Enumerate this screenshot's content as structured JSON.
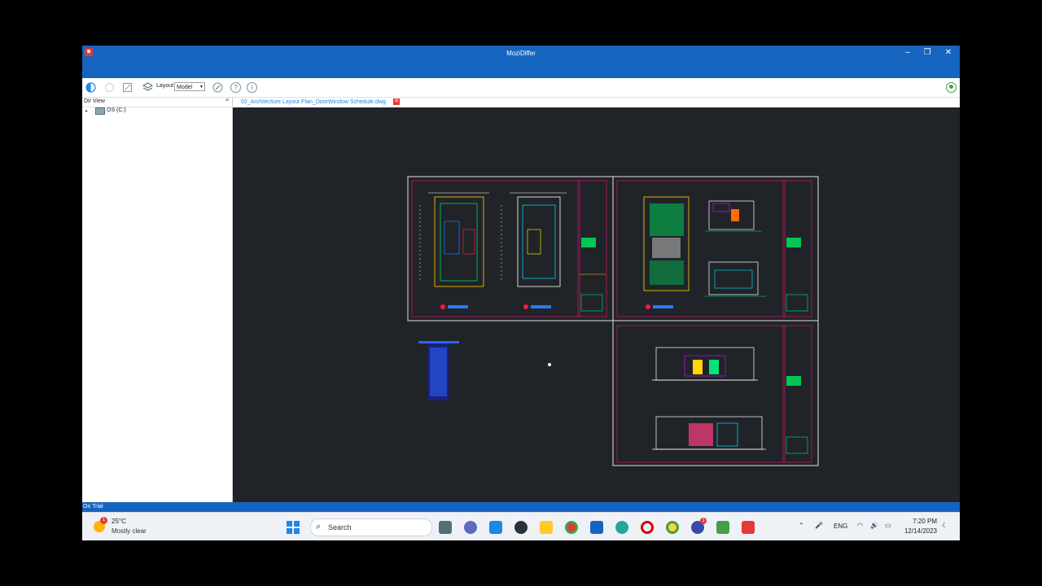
{
  "window": {
    "title": "MoziDiffer"
  },
  "titlebar": {
    "minimize": "–",
    "restore": "❐",
    "close": "✕"
  },
  "toolbar": {
    "layout_label": "Layout",
    "layout_value": "Model"
  },
  "sidebar": {
    "header": "Dir View",
    "pin": "¤",
    "tree": [
      {
        "label": "OS (C:)"
      }
    ]
  },
  "document": {
    "tab_label": "02_Architecture Layout Plan_DoorWindow Schedule.dwg",
    "close_glyph": "✕"
  },
  "status": {
    "text": "On Trial"
  },
  "taskbar": {
    "weather": {
      "temp": "25°C",
      "desc": "Mostly clear",
      "badge": "1"
    },
    "search_label": "Search",
    "language": "ENG",
    "time": "7:20 PM",
    "date": "12/14/2023",
    "chat_badge": "1"
  },
  "colors": {
    "titlebar": "#1565c0",
    "canvas": "#202429",
    "accent": "#1e88e5",
    "trial_bar": "#1565c0"
  }
}
